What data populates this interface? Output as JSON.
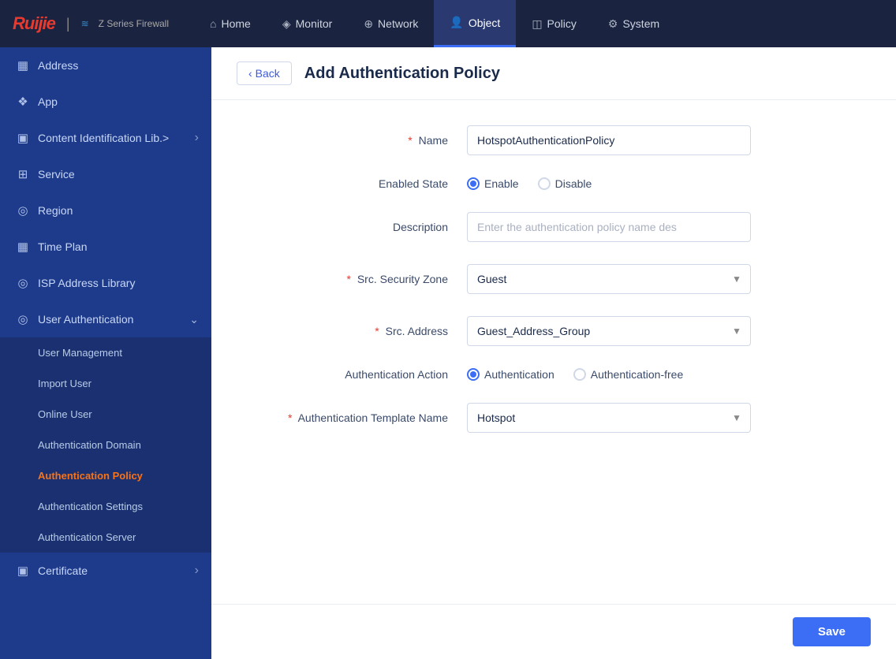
{
  "nav": {
    "logo": "Ruijie",
    "logo_subtitle": "Z Series Firewall",
    "items": [
      {
        "id": "home",
        "label": "Home",
        "icon": "⌂",
        "active": false
      },
      {
        "id": "monitor",
        "label": "Monitor",
        "icon": "◈",
        "active": false
      },
      {
        "id": "network",
        "label": "Network",
        "icon": "⊕",
        "active": false
      },
      {
        "id": "object",
        "label": "Object",
        "icon": "👤",
        "active": true
      },
      {
        "id": "policy",
        "label": "Policy",
        "icon": "◫",
        "active": false
      },
      {
        "id": "system",
        "label": "System",
        "icon": "⚙",
        "active": false
      }
    ]
  },
  "sidebar": {
    "items": [
      {
        "id": "address",
        "label": "Address",
        "icon": "▦",
        "has_chevron": false
      },
      {
        "id": "app",
        "label": "App",
        "icon": "❖",
        "has_chevron": false
      },
      {
        "id": "content-id",
        "label": "Content Identification Lib.>",
        "icon": "▣",
        "has_chevron": false
      },
      {
        "id": "service",
        "label": "Service",
        "icon": "⊞",
        "has_chevron": false
      },
      {
        "id": "region",
        "label": "Region",
        "icon": "◎",
        "has_chevron": false
      },
      {
        "id": "time-plan",
        "label": "Time Plan",
        "icon": "▦",
        "has_chevron": false
      },
      {
        "id": "isp-address",
        "label": "ISP Address Library",
        "icon": "◎",
        "has_chevron": false
      },
      {
        "id": "user-auth",
        "label": "User Authentication",
        "icon": "◎",
        "has_chevron_down": true
      }
    ],
    "sub_items": [
      {
        "id": "user-mgmt",
        "label": "User Management"
      },
      {
        "id": "import-user",
        "label": "Import User"
      },
      {
        "id": "online-user",
        "label": "Online User"
      },
      {
        "id": "auth-domain",
        "label": "Authentication Domain"
      },
      {
        "id": "auth-policy",
        "label": "Authentication Policy",
        "active": true
      },
      {
        "id": "auth-settings",
        "label": "Authentication Settings"
      },
      {
        "id": "auth-server",
        "label": "Authentication Server"
      }
    ],
    "certificate": {
      "label": "Certificate",
      "icon": "▣",
      "has_chevron": true
    }
  },
  "page": {
    "back_label": "Back",
    "title": "Add Authentication Policy"
  },
  "form": {
    "name_label": "Name",
    "name_value": "HotspotAuthenticationPolicy",
    "enabled_state_label": "Enabled State",
    "enable_label": "Enable",
    "disable_label": "Disable",
    "enable_selected": true,
    "description_label": "Description",
    "description_placeholder": "Enter the authentication policy name des",
    "src_security_zone_label": "Src. Security Zone",
    "src_security_zone_value": "Guest",
    "src_address_label": "Src. Address",
    "src_address_value": "Guest_Address_Group",
    "auth_action_label": "Authentication Action",
    "auth_action_option1": "Authentication",
    "auth_action_option2": "Authentication-free",
    "auth_action_selected": "Authentication",
    "auth_template_label": "Authentication Template Name",
    "auth_template_value": "Hotspot"
  },
  "footer": {
    "save_label": "Save"
  }
}
